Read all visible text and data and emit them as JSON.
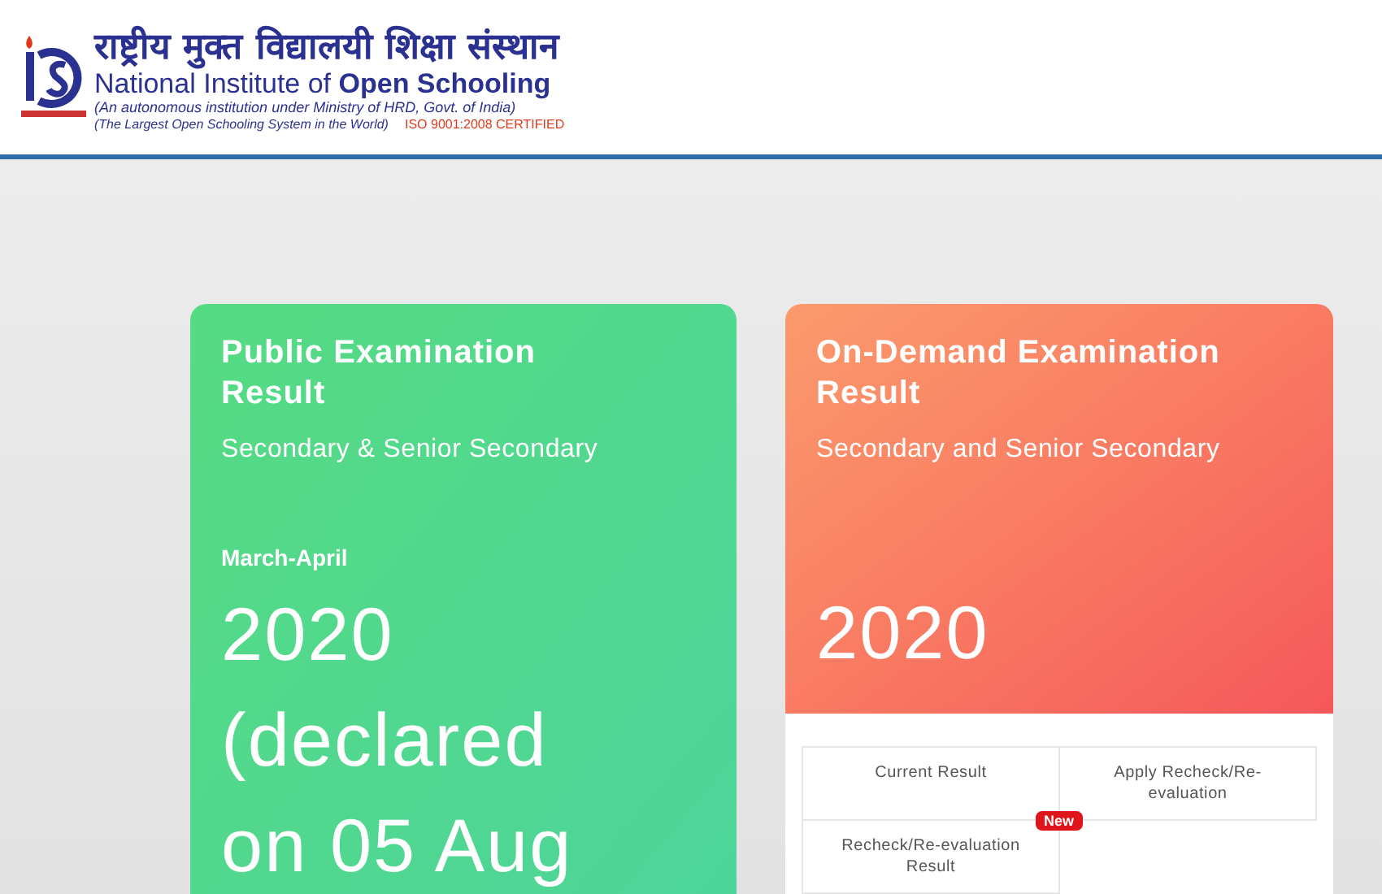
{
  "header": {
    "hindi_name": "राष्ट्रीय मुक्त विद्यालयी शिक्षा संस्थान",
    "name": "National Institute of **Open Schooling**",
    "tagline_1": "(An autonomous institution under  Ministry of HRD, Govt. of India)",
    "tagline_2": "(The Largest Open Schooling System in the World)",
    "certification": "ISO 9001:2008 CERTIFIED"
  },
  "cards": [
    {
      "kind": "public",
      "title": "Public Examination Result",
      "subtitle": "Secondary & Senior Secondary",
      "session": "March-April",
      "year": "2020 (declared on 05 Aug"
    },
    {
      "kind": "ondemand",
      "title": "On-Demand Examination Result",
      "subtitle": "Secondary and Senior Secondary",
      "year": "2020",
      "links": [
        {
          "label": "Current Result"
        },
        {
          "label": "Apply Recheck/Re-evaluation"
        },
        {
          "label": "Recheck/Re-evaluation Result",
          "badge": "New"
        }
      ]
    }
  ]
}
